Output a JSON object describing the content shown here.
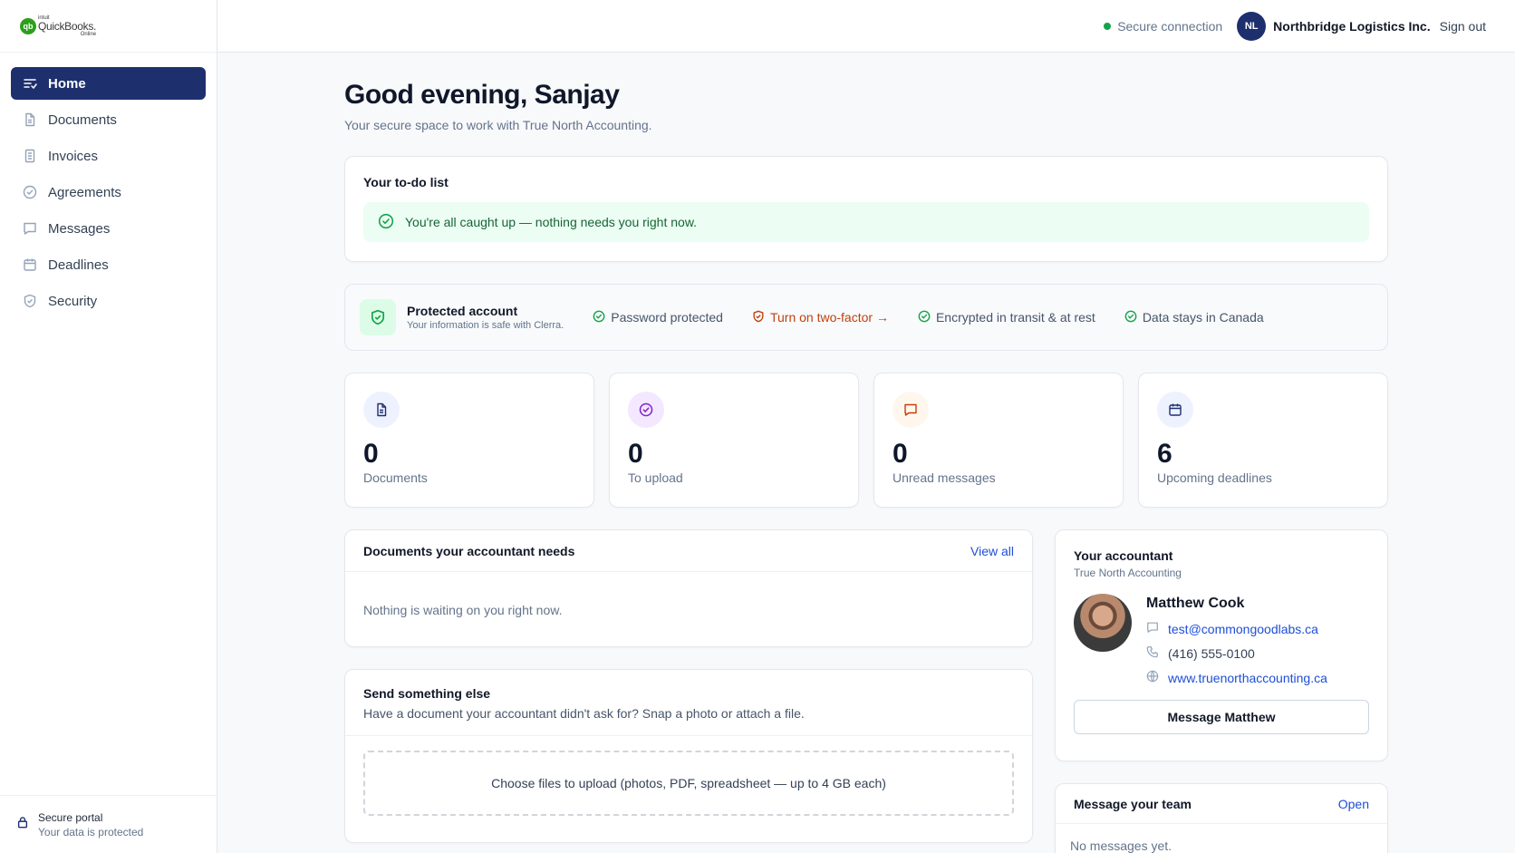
{
  "brand": {
    "line1": "intuit",
    "line2": "QuickBooks.",
    "line3": "Online"
  },
  "sidebar": {
    "items": [
      {
        "label": "Home",
        "icon": "home-list-icon",
        "active": true
      },
      {
        "label": "Documents",
        "icon": "document-icon"
      },
      {
        "label": "Invoices",
        "icon": "invoice-icon"
      },
      {
        "label": "Agreements",
        "icon": "check-circle-icon"
      },
      {
        "label": "Messages",
        "icon": "message-icon"
      },
      {
        "label": "Deadlines",
        "icon": "calendar-icon"
      },
      {
        "label": "Security",
        "icon": "shield-icon"
      }
    ],
    "footer": {
      "title": "Secure portal",
      "subtitle": "Your data is protected"
    }
  },
  "topbar": {
    "secure_label": "Secure connection",
    "avatar_initials": "NL",
    "company": "Northbridge Logistics Inc.",
    "signout": "Sign out"
  },
  "greeting": {
    "title": "Good evening, Sanjay",
    "subtitle": "Your secure space to work with True North Accounting."
  },
  "todo": {
    "title": "Your to-do list",
    "message": "You're all caught up — nothing needs you right now."
  },
  "protection": {
    "title": "Protected account",
    "subtitle": "Your information is safe with Clerra.",
    "features": [
      {
        "label": "Password protected",
        "status": "ok"
      },
      {
        "label": "Turn on two-factor →",
        "status": "warn"
      },
      {
        "label": "Encrypted in transit & at rest",
        "status": "ok"
      },
      {
        "label": "Data stays in Canada",
        "status": "ok"
      }
    ]
  },
  "stats": [
    {
      "value": "0",
      "label": "Documents",
      "icon": "document-icon",
      "bg": "#eef2ff",
      "color": "#1e2f6e"
    },
    {
      "value": "0",
      "label": "To upload",
      "icon": "check-circle-icon",
      "bg": "#f3e8ff",
      "color": "#7e22ce"
    },
    {
      "value": "0",
      "label": "Unread messages",
      "icon": "message-icon",
      "bg": "#fff7ed",
      "color": "#c2410c"
    },
    {
      "value": "6",
      "label": "Upcoming deadlines",
      "icon": "calendar-icon",
      "bg": "#eef2ff",
      "color": "#1e2f6e"
    }
  ],
  "needs": {
    "title": "Documents your accountant needs",
    "view_all": "View all",
    "empty": "Nothing is waiting on you right now."
  },
  "send": {
    "title": "Send something else",
    "subtitle": "Have a document your accountant didn't ask for? Snap a photo or attach a file.",
    "dropzone": "Choose files to upload (photos, PDF, spreadsheet — up to 4 GB each)"
  },
  "accountant": {
    "title": "Your accountant",
    "firm": "True North Accounting",
    "name": "Matthew Cook",
    "email": "test@commongoodlabs.ca",
    "phone": "(416) 555-0100",
    "website": "www.truenorthaccounting.ca",
    "button": "Message Matthew"
  },
  "team": {
    "title": "Message your team",
    "open": "Open",
    "empty": "No messages yet."
  }
}
